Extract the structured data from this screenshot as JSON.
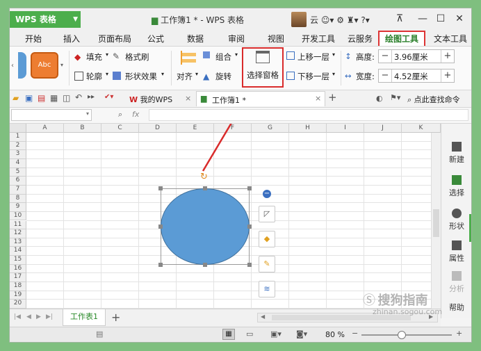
{
  "app": {
    "name": "WPS 表格",
    "doc_title": "工作簿1 * - WPS 表格",
    "user_initial": "云"
  },
  "menu_tabs": [
    "开始",
    "插入",
    "页面布局",
    "公式",
    "数据",
    "审阅",
    "视图",
    "开发工具",
    "云服务",
    "绘图工具",
    "文本工具"
  ],
  "active_tab": "绘图工具",
  "ribbon": {
    "style_preview": "Abc",
    "fill": "填充",
    "format_brush": "格式刷",
    "outline": "轮廓",
    "shape_effects": "形状效果",
    "align": "对齐",
    "group": "组合",
    "rotate": "旋转",
    "selection_pane": "选择窗格",
    "bring_forward": "上移一层",
    "send_backward": "下移一层",
    "height_label": "高度:",
    "height_value": "3.96厘米",
    "width_label": "宽度:",
    "width_value": "4.52厘米"
  },
  "quickbar": {
    "my_wps": "我的WPS",
    "doc_tab": "工作簿1 *",
    "search": "点此查找命令"
  },
  "formula": {
    "fx": "fx"
  },
  "columns": [
    "A",
    "B",
    "C",
    "D",
    "E",
    "F",
    "G",
    "H",
    "I",
    "J",
    "K"
  ],
  "rows": [
    "1",
    "2",
    "3",
    "4",
    "5",
    "6",
    "7",
    "8",
    "9",
    "10",
    "11",
    "12",
    "13",
    "14",
    "15",
    "16",
    "17",
    "18",
    "19",
    "20"
  ],
  "right_pane": [
    "新建",
    "选择",
    "形状",
    "属性",
    "分析",
    "帮助"
  ],
  "sheet_tab": "工作表1",
  "status": {
    "zoom": "80 %"
  },
  "watermark": {
    "brand": "搜狗指南",
    "url": "zhinan.sogou.com"
  },
  "colors": {
    "accent_green": "#4cae4c",
    "highlight_red": "#d92b2b",
    "ellipse_fill": "#5b9bd5"
  }
}
